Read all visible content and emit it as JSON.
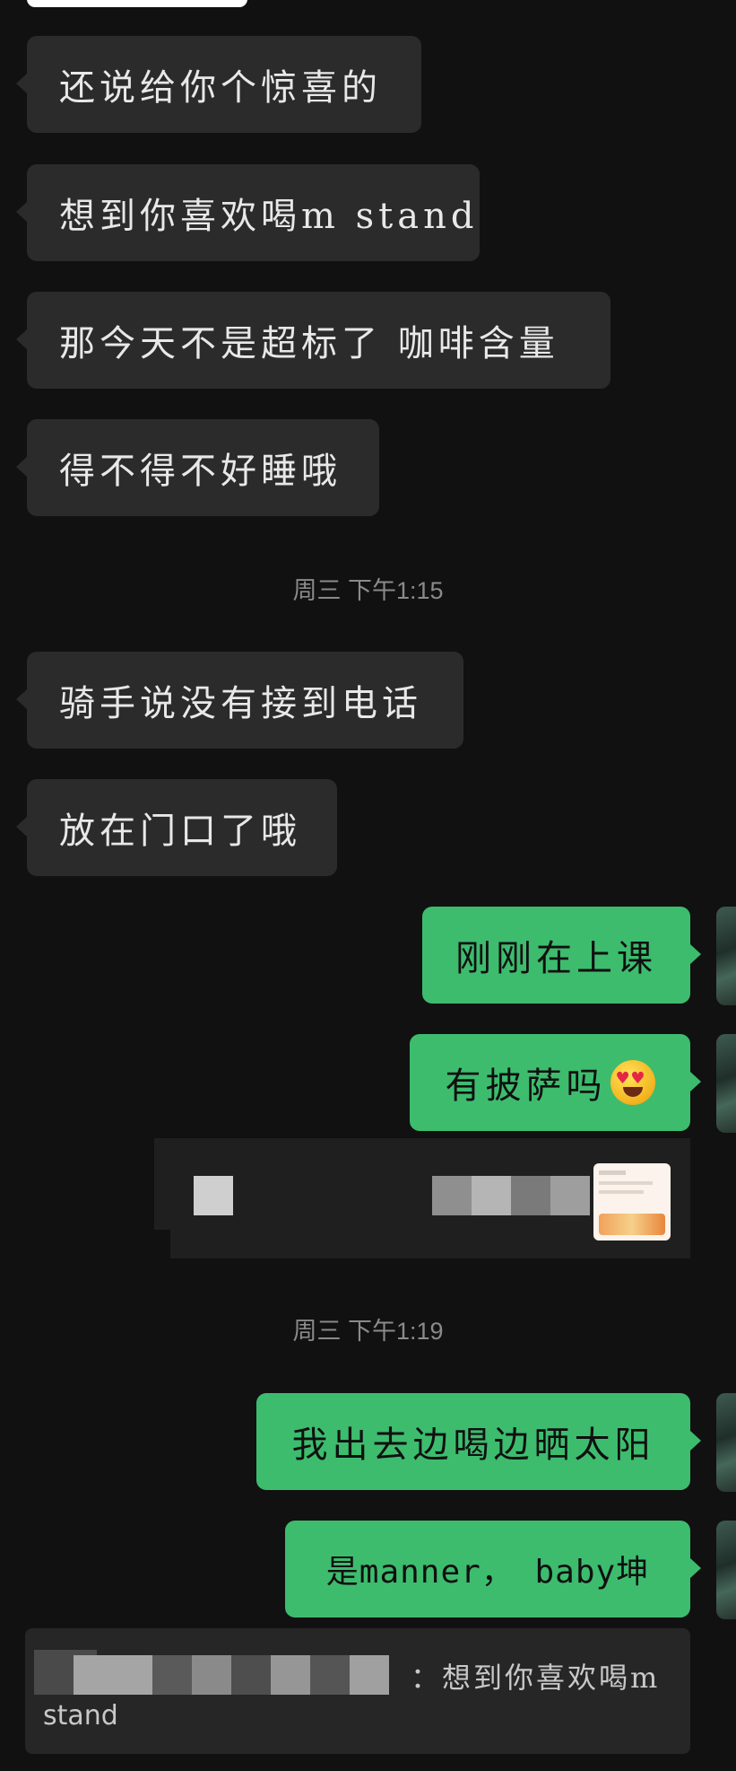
{
  "messages": [
    {
      "side": "in",
      "text": "还说给你个惊喜的"
    },
    {
      "side": "in",
      "text": "想到你喜欢喝m stand"
    },
    {
      "side": "in",
      "text": "那今天不是超标了 咖啡含量"
    },
    {
      "side": "in",
      "text": "得不得不好睡哦"
    },
    {
      "side": "in",
      "text": "骑手说没有接到电话"
    },
    {
      "side": "in",
      "text": "放在门口了哦"
    },
    {
      "side": "out",
      "text": "刚刚在上课"
    },
    {
      "side": "out",
      "text": "有披萨吗"
    },
    {
      "side": "out",
      "text": "我出去边喝边晒太阳"
    },
    {
      "side": "out",
      "text": "是manner， baby坤"
    }
  ],
  "timestamps": [
    "周三 下午1:15",
    "周三 下午1:19"
  ],
  "emoji": "heart-eyes-emoji",
  "quote": {
    "separator_and_text": "：想到你喜欢喝m",
    "text_line2": "stand"
  },
  "colors": {
    "background": "#111111",
    "incoming_bubble": "#2b2b2b",
    "outgoing_bubble": "#3dbc6e",
    "timestamp": "#8a8a8a"
  }
}
